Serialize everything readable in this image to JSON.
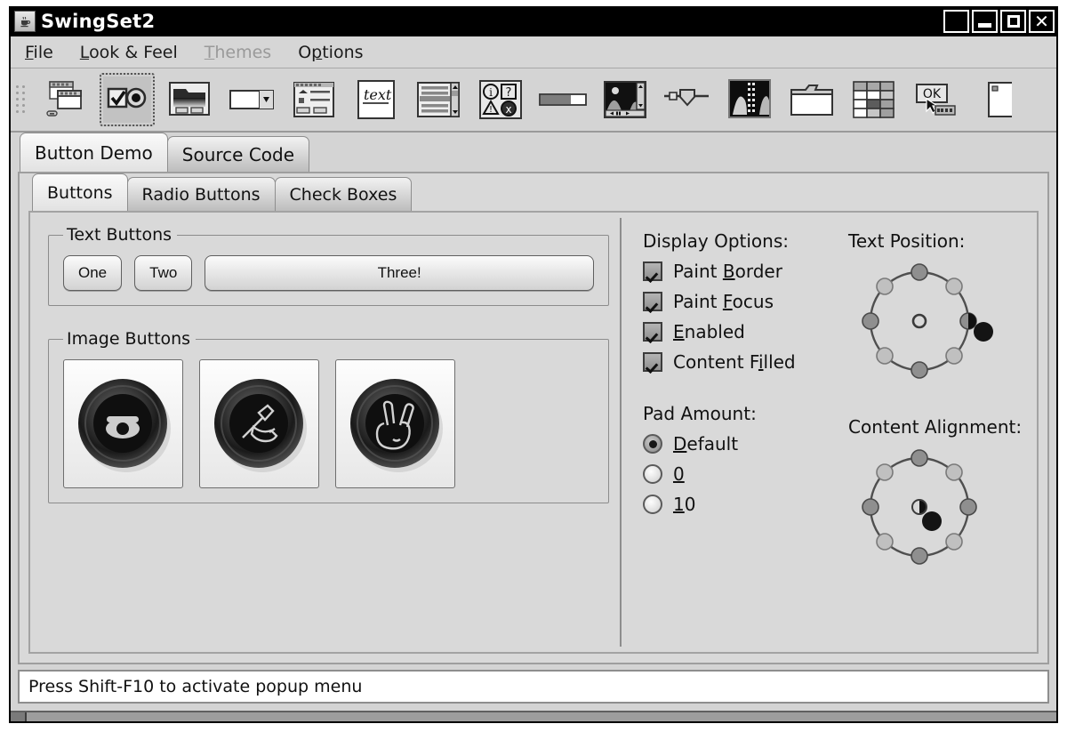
{
  "window": {
    "title": "SwingSet2",
    "icon": "java-cup-icon",
    "controls": [
      {
        "name": "blank-button",
        "glyph": ""
      },
      {
        "name": "minimize-button",
        "glyph": "_"
      },
      {
        "name": "maximize-button",
        "glyph": "□"
      },
      {
        "name": "close-button",
        "glyph": "✕"
      }
    ]
  },
  "menubar": {
    "items": [
      {
        "label": "File",
        "mnemonic": "F",
        "disabled": false
      },
      {
        "label": "Look & Feel",
        "mnemonic": "L",
        "disabled": false
      },
      {
        "label": "Themes",
        "mnemonic": "T",
        "disabled": true
      },
      {
        "label": "Options",
        "mnemonic": "p",
        "disabled": false
      }
    ]
  },
  "toolbar": {
    "grip": "drag-handle",
    "buttons": [
      {
        "name": "internal-frame-demo-button",
        "icon": "window-frames-icon",
        "selected": false
      },
      {
        "name": "button-demo-button",
        "icon": "checkbox-radio-icon",
        "selected": true
      },
      {
        "name": "file-chooser-demo-button",
        "icon": "folder-chooser-icon",
        "selected": false
      },
      {
        "name": "combo-box-demo-button",
        "icon": "combobox-icon",
        "selected": false
      },
      {
        "name": "list-demo-button",
        "icon": "list-panel-icon",
        "selected": false
      },
      {
        "name": "text-demo-button",
        "icon": "text-editor-icon",
        "selected": false
      },
      {
        "name": "scroll-pane-demo-button",
        "icon": "scrollpane-icon",
        "selected": false
      },
      {
        "name": "option-pane-demo-button",
        "icon": "option-pane-icon",
        "selected": false
      },
      {
        "name": "progress-bar-demo-button",
        "icon": "progress-bar-icon",
        "selected": false
      },
      {
        "name": "slider-demo-button",
        "icon": "media-image-icon",
        "selected": false
      },
      {
        "name": "split-pane-demo-button",
        "icon": "slider-knob-icon",
        "selected": false
      },
      {
        "name": "tabbed-pane-demo-button",
        "icon": "filmstrip-split-icon",
        "selected": false
      },
      {
        "name": "folder-tab-demo-button",
        "icon": "tabbed-folder-icon",
        "selected": false
      },
      {
        "name": "table-demo-button",
        "icon": "table-grid-icon",
        "selected": false
      },
      {
        "name": "tool-tip-demo-button",
        "icon": "tooltip-ok-icon",
        "selected": false
      },
      {
        "name": "tree-demo-button",
        "icon": "tree-icon",
        "selected": false
      }
    ]
  },
  "outer_tabs": [
    {
      "label": "Button Demo",
      "active": true
    },
    {
      "label": "Source Code",
      "active": false
    }
  ],
  "inner_tabs": [
    {
      "label": "Buttons",
      "active": true
    },
    {
      "label": "Radio Buttons",
      "active": false
    },
    {
      "label": "Check Boxes",
      "active": false
    }
  ],
  "text_buttons": {
    "legend": "Text Buttons",
    "buttons": [
      {
        "label": "One",
        "wide": false
      },
      {
        "label": "Two",
        "wide": false
      },
      {
        "label": "Three!",
        "wide": true
      }
    ]
  },
  "image_buttons": {
    "legend": "Image Buttons",
    "buttons": [
      {
        "name": "phone-image-button",
        "icon": "telephone-icon"
      },
      {
        "name": "write-image-button",
        "icon": "writing-hand-icon"
      },
      {
        "name": "peace-image-button",
        "icon": "victory-hand-icon"
      }
    ]
  },
  "display_options": {
    "title": "Display Options:",
    "checkboxes": [
      {
        "label": "Paint Border",
        "mnemonic": "B",
        "checked": true
      },
      {
        "label": "Paint Focus",
        "mnemonic": "F",
        "checked": true
      },
      {
        "label": "Enabled",
        "mnemonic": "E",
        "checked": true
      },
      {
        "label": "Content Filled",
        "mnemonic": "i",
        "checked": true
      }
    ]
  },
  "pad_amount": {
    "title": "Pad Amount:",
    "radios": [
      {
        "label": "Default",
        "mnemonic": "D",
        "selected": true
      },
      {
        "label": "0",
        "mnemonic": "0",
        "selected": false
      },
      {
        "label": "10",
        "mnemonic": "1",
        "selected": false
      }
    ]
  },
  "text_position": {
    "title": "Text Position:",
    "selected": "east"
  },
  "content_alignment": {
    "title": "Content Alignment:",
    "selected": "center"
  },
  "statusbar": {
    "message": "Press Shift-F10 to activate popup menu"
  },
  "colors": {
    "window_bg": "#d4d4d4",
    "titlebar_bg": "#000000",
    "titlebar_fg": "#ffffff",
    "text": "#111111",
    "disabled_text": "#9a9a9a",
    "border": "#8c8c8c",
    "status_bg": "#ffffff"
  }
}
